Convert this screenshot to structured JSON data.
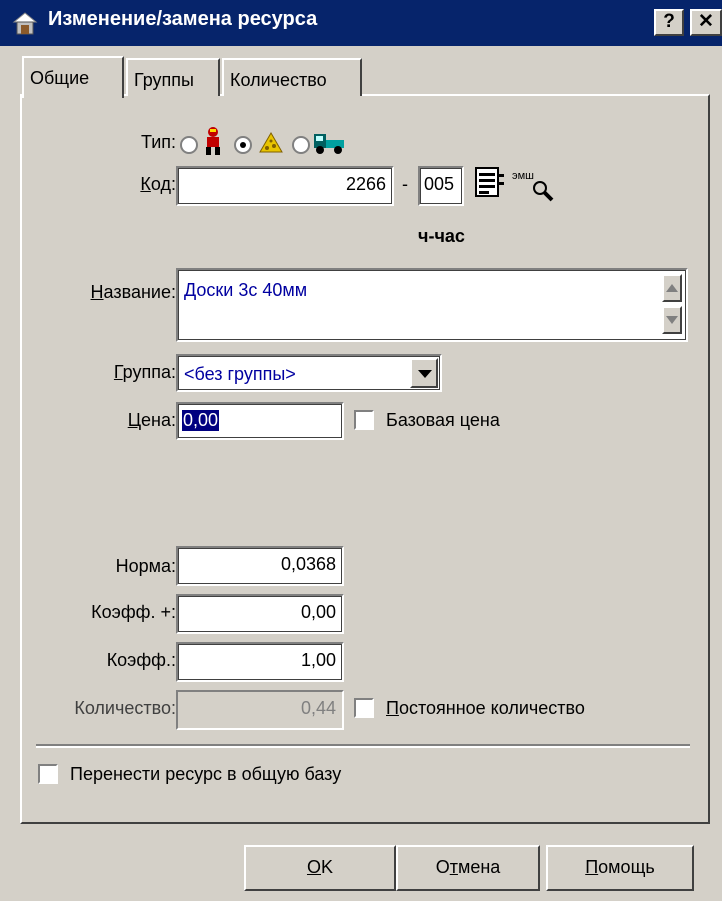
{
  "window": {
    "title": "Изменение/замена ресурса",
    "help_btn": "?",
    "close_btn": "✕"
  },
  "tabs": [
    {
      "label": "Общие"
    },
    {
      "label": "Группы"
    },
    {
      "label": "Количество"
    }
  ],
  "type_row": {
    "label": "Тип:"
  },
  "code": {
    "label": "Код:",
    "value": "2266",
    "separator": "-",
    "suffix": "005",
    "tag": "эмш"
  },
  "unit": "ч-час",
  "name": {
    "label": "Название:",
    "value": "Доски 3с 40мм"
  },
  "group": {
    "label": "Группа:",
    "value": "<без группы>"
  },
  "price": {
    "label": "Цена:",
    "value": "0,00",
    "base_price_label": "Базовая цена"
  },
  "norm": {
    "label": "Норма:",
    "value": "0,0368"
  },
  "coef_plus": {
    "label": "Коэфф. +:",
    "value": "0,00"
  },
  "coef": {
    "label": "Коэфф.:",
    "value": "1,00"
  },
  "quantity": {
    "label": "Количество:",
    "value": "0,44",
    "const_label": "Постоянное количество"
  },
  "transfer_label": "Перенести ресурс в общую базу",
  "buttons": {
    "ok": "OK",
    "cancel": "Отмена",
    "help": "Помощь"
  }
}
